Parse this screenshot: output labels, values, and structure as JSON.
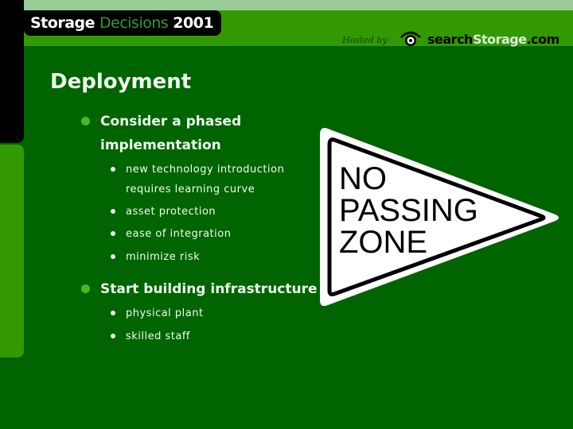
{
  "header": {
    "title_word1": "Storage",
    "title_word2": "Decisions",
    "title_word3": "2001",
    "hosted_by": "Hosted by",
    "host_part1": "search",
    "host_part2": "Storage",
    "host_part3": ".com"
  },
  "slide": {
    "heading": "Deployment",
    "bullets": [
      {
        "line1": "Consider a phased",
        "line2": "implementation",
        "sub": [
          {
            "line1": "new technology introduction",
            "line2": "requires learning curve"
          },
          {
            "line1": "asset protection"
          },
          {
            "line1": "ease of integration"
          },
          {
            "line1": "minimize risk"
          }
        ]
      },
      {
        "line1": "Start building infrastructure",
        "sub": [
          {
            "line1": "physical plant"
          },
          {
            "line1": "skilled staff"
          }
        ]
      }
    ]
  },
  "sign": {
    "line1": "NO",
    "line2": "PASSING",
    "line3": "ZONE"
  },
  "colors": {
    "background": "#006400",
    "band_light": "#99cc99",
    "band_mid": "#339900",
    "bullet": "#44bb22"
  }
}
